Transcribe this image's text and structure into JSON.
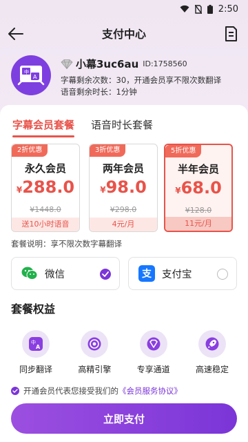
{
  "status_bar": {
    "time": "2:50"
  },
  "nav": {
    "title": "支付中心"
  },
  "profile": {
    "name": "小幕3uc6au",
    "uid": "ID:1758560",
    "subtitle_line": "字幕剩余次数：30，开通会员享不限次数翻译",
    "voice_line": "语音剩余时长：1分钟"
  },
  "tabs": [
    {
      "label": "字幕会员套餐",
      "active": true
    },
    {
      "label": "语音时长套餐",
      "active": false
    }
  ],
  "plans": [
    {
      "badge": "2折优惠",
      "name": "永久会员",
      "currency": "¥",
      "price": "288.0",
      "original": "¥1448.0",
      "footer": "送10小时语音",
      "selected": false
    },
    {
      "badge": "3折优惠",
      "name": "两年会员",
      "currency": "¥",
      "price": "98.0",
      "original": "¥298.0",
      "footer": "4元/月",
      "selected": false
    },
    {
      "badge": "5折优惠",
      "name": "半年会员",
      "currency": "¥",
      "price": "68.0",
      "original": "¥128.0",
      "footer": "11元/月",
      "selected": true
    }
  ],
  "plan_description": "套餐说明：享不限次数字幕翻译",
  "payment_methods": [
    {
      "label": "微信",
      "icon": "wechat-icon",
      "selected": true
    },
    {
      "label": "支付宝",
      "icon": "alipay-icon",
      "selected": false
    }
  ],
  "benefits": {
    "title": "套餐权益",
    "items": [
      {
        "label": "同步翻译",
        "icon": "translate-icon"
      },
      {
        "label": "高精引擎",
        "icon": "target-icon"
      },
      {
        "label": "专享通道",
        "icon": "vip-diamond-icon"
      },
      {
        "label": "高速稳定",
        "icon": "rocket-icon"
      }
    ]
  },
  "agreement": {
    "text": "开通会员代表您接受我们的",
    "link": "《会员服务协议》"
  },
  "pay_button": {
    "label": "立即支付"
  },
  "colors": {
    "accent_purple": "#7b35d8",
    "price_red": "#e8534a",
    "wechat_green": "#22b14c",
    "alipay_blue": "#1677ff"
  }
}
